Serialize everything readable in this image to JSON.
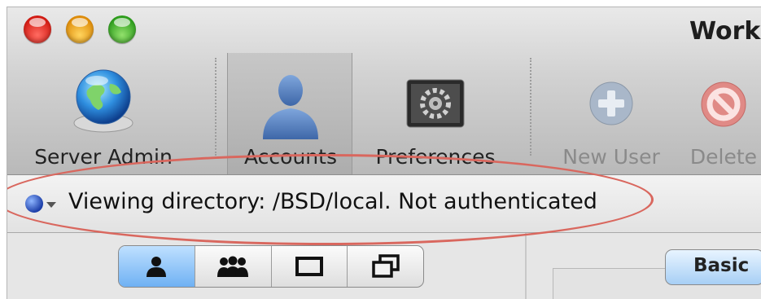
{
  "window": {
    "title": "Work"
  },
  "toolbar": {
    "server_admin_label": "Server Admin",
    "accounts_label": "Accounts",
    "preferences_label": "Preferences",
    "new_user_label": "New User",
    "delete_label": "Delete"
  },
  "directory_bar": {
    "status_text": "Viewing directory: /BSD/local.  Not authenticated"
  },
  "account_type_segments": [
    {
      "icon": "user-icon",
      "selected": true
    },
    {
      "icon": "group-icon",
      "selected": false
    },
    {
      "icon": "computer-icon",
      "selected": false
    },
    {
      "icon": "computer-group-icon",
      "selected": false
    }
  ],
  "detail_tabs": {
    "basic_label": "Basic"
  },
  "colors": {
    "annotation_oval": "#d9675e",
    "segment_selected": "#6fb1f3"
  }
}
